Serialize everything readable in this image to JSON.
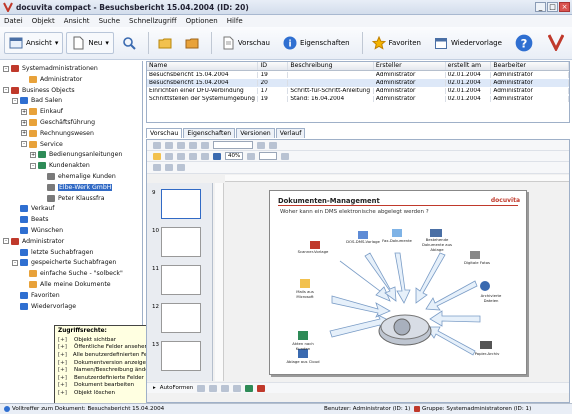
{
  "window": {
    "title": "docuvita compact - Besuchsbericht 15.04.2004 (ID: 20)"
  },
  "menu": [
    "Datei",
    "Objekt",
    "Ansicht",
    "Suche",
    "Schnellzugriff",
    "Optionen",
    "Hilfe"
  ],
  "toolbar": {
    "ansicht_label": "Ansicht",
    "neu_label": "Neu",
    "vorschau_label": "Vorschau",
    "eigenschaften_label": "Eigenschaften",
    "favoriten_label": "Favoriten",
    "wiedervorlage_label": "Wiedervorlage"
  },
  "tree": [
    {
      "label": "Systemadministrationen",
      "depth": 0,
      "exp": "-"
    },
    {
      "label": "Administrator",
      "depth": 2,
      "exp": ""
    },
    {
      "label": "Business Objects",
      "depth": 0,
      "exp": "-"
    },
    {
      "label": "Bad Salen",
      "depth": 1,
      "exp": "-"
    },
    {
      "label": "Einkauf",
      "depth": 2,
      "exp": "+"
    },
    {
      "label": "Geschäftsführung",
      "depth": 2,
      "exp": "+"
    },
    {
      "label": "Rechnungswesen",
      "depth": 2,
      "exp": "+"
    },
    {
      "label": "Service",
      "depth": 2,
      "exp": "-"
    },
    {
      "label": "Bedienungsanleitungen",
      "depth": 3,
      "exp": "+"
    },
    {
      "label": "Kundenakten",
      "depth": 3,
      "exp": "-"
    },
    {
      "label": "ehemalige Kunden",
      "depth": 4,
      "exp": ""
    },
    {
      "label": "Elbe-Werk GmbH",
      "depth": 4,
      "exp": "",
      "selected": true
    },
    {
      "label": "Peter Klaussfra",
      "depth": 4,
      "exp": ""
    },
    {
      "label": "Verkauf",
      "depth": 1,
      "exp": ""
    },
    {
      "label": "Beats",
      "depth": 1,
      "exp": ""
    },
    {
      "label": "Wünschen",
      "depth": 1,
      "exp": ""
    },
    {
      "label": "Administrator",
      "depth": 0,
      "exp": "-"
    },
    {
      "label": "letzte Suchabfragen",
      "depth": 1,
      "exp": ""
    },
    {
      "label": "gespeicherte Suchabfragen",
      "depth": 1,
      "exp": "-"
    },
    {
      "label": "einfache Suche - \"solbeck\"",
      "depth": 2,
      "exp": ""
    },
    {
      "label": "Alle meine Dokumente",
      "depth": 2,
      "exp": ""
    },
    {
      "label": "Favoriten",
      "depth": 1,
      "exp": ""
    },
    {
      "label": "Wiedervorlage",
      "depth": 1,
      "exp": ""
    }
  ],
  "tooltip": {
    "title": "Zugriffsrechte:",
    "rows": [
      {
        "key": "[+]",
        "text": "Objekt sichtbar"
      },
      {
        "key": "[+]",
        "text": "Öffentliche Felder ansehen"
      },
      {
        "key": "[+]",
        "text": "Alle benutzerdefinierten Felder ansehen"
      },
      {
        "key": "[+]",
        "text": "Dokumentversion anzeigen"
      },
      {
        "key": "[+]",
        "text": "Namen/Beschreibung ändern"
      },
      {
        "key": "[+]",
        "text": "Benutzerdefinierte Felder ändern"
      },
      {
        "key": "[+]",
        "text": "Dokument bearbeiten"
      },
      {
        "key": "[+]",
        "text": "Objekt löschen"
      }
    ]
  },
  "list": {
    "columns": [
      "Name",
      "ID",
      "Beschreibung",
      "Ersteller",
      "erstellt am",
      "Bearbeiter"
    ],
    "rows": [
      [
        "Besuchsbericht 15.04.2004",
        "19",
        "",
        "Administrator",
        "02.01.2004",
        "Administrator"
      ],
      [
        "Besuchsbericht 15.04.2004",
        "20",
        "",
        "Administrator",
        "02.01.2004",
        "Administrator"
      ],
      [
        "Einrichten einer DFÜ-Verbindung",
        "17",
        "Schritt-für-Schritt-Anleitung",
        "Administrator",
        "02.01.2004",
        "Administrator"
      ],
      [
        "Schnittstellen der Systemumgebung",
        "19",
        "Stand: 16.04.2004",
        "Administrator",
        "02.01.2004",
        "Administrator"
      ]
    ]
  },
  "tabs": [
    "Vorschau",
    "Eigenschaften",
    "Versionen",
    "Verlauf"
  ],
  "preview": {
    "zoom": "40%",
    "slide_title": "Dokumenten-Management",
    "slide_logo": "docuvita",
    "slide_subtitle": "Woher kann ein DMS elektronische abgelegt werden ?",
    "slide_labels": [
      "Scanner-Vorlage",
      "DOS-DMS-Vorlage",
      "Bestehende Dokumente aus Ablage",
      "Digitale Fotos",
      "Archivierte Dateien",
      "Fax-Dokumente",
      "Mails aus Microsoft",
      "Akten nach Kunden",
      "Ablage aus Cloud",
      "Papier-Archiv"
    ],
    "thumb_numbers": [
      "9",
      "10",
      "11",
      "12",
      "13"
    ],
    "draw_label": "AutoFormen"
  },
  "status": {
    "left": "Volltreffer zum Dokument: Besuchsbericht 15.04.2004",
    "user": "Benutzer: Administrator (ID: 1)",
    "group": "Gruppe: Systemadministratoren (ID: 1)"
  },
  "colors": {
    "accent": "#316ac5",
    "brand_red": "#c0392b"
  }
}
